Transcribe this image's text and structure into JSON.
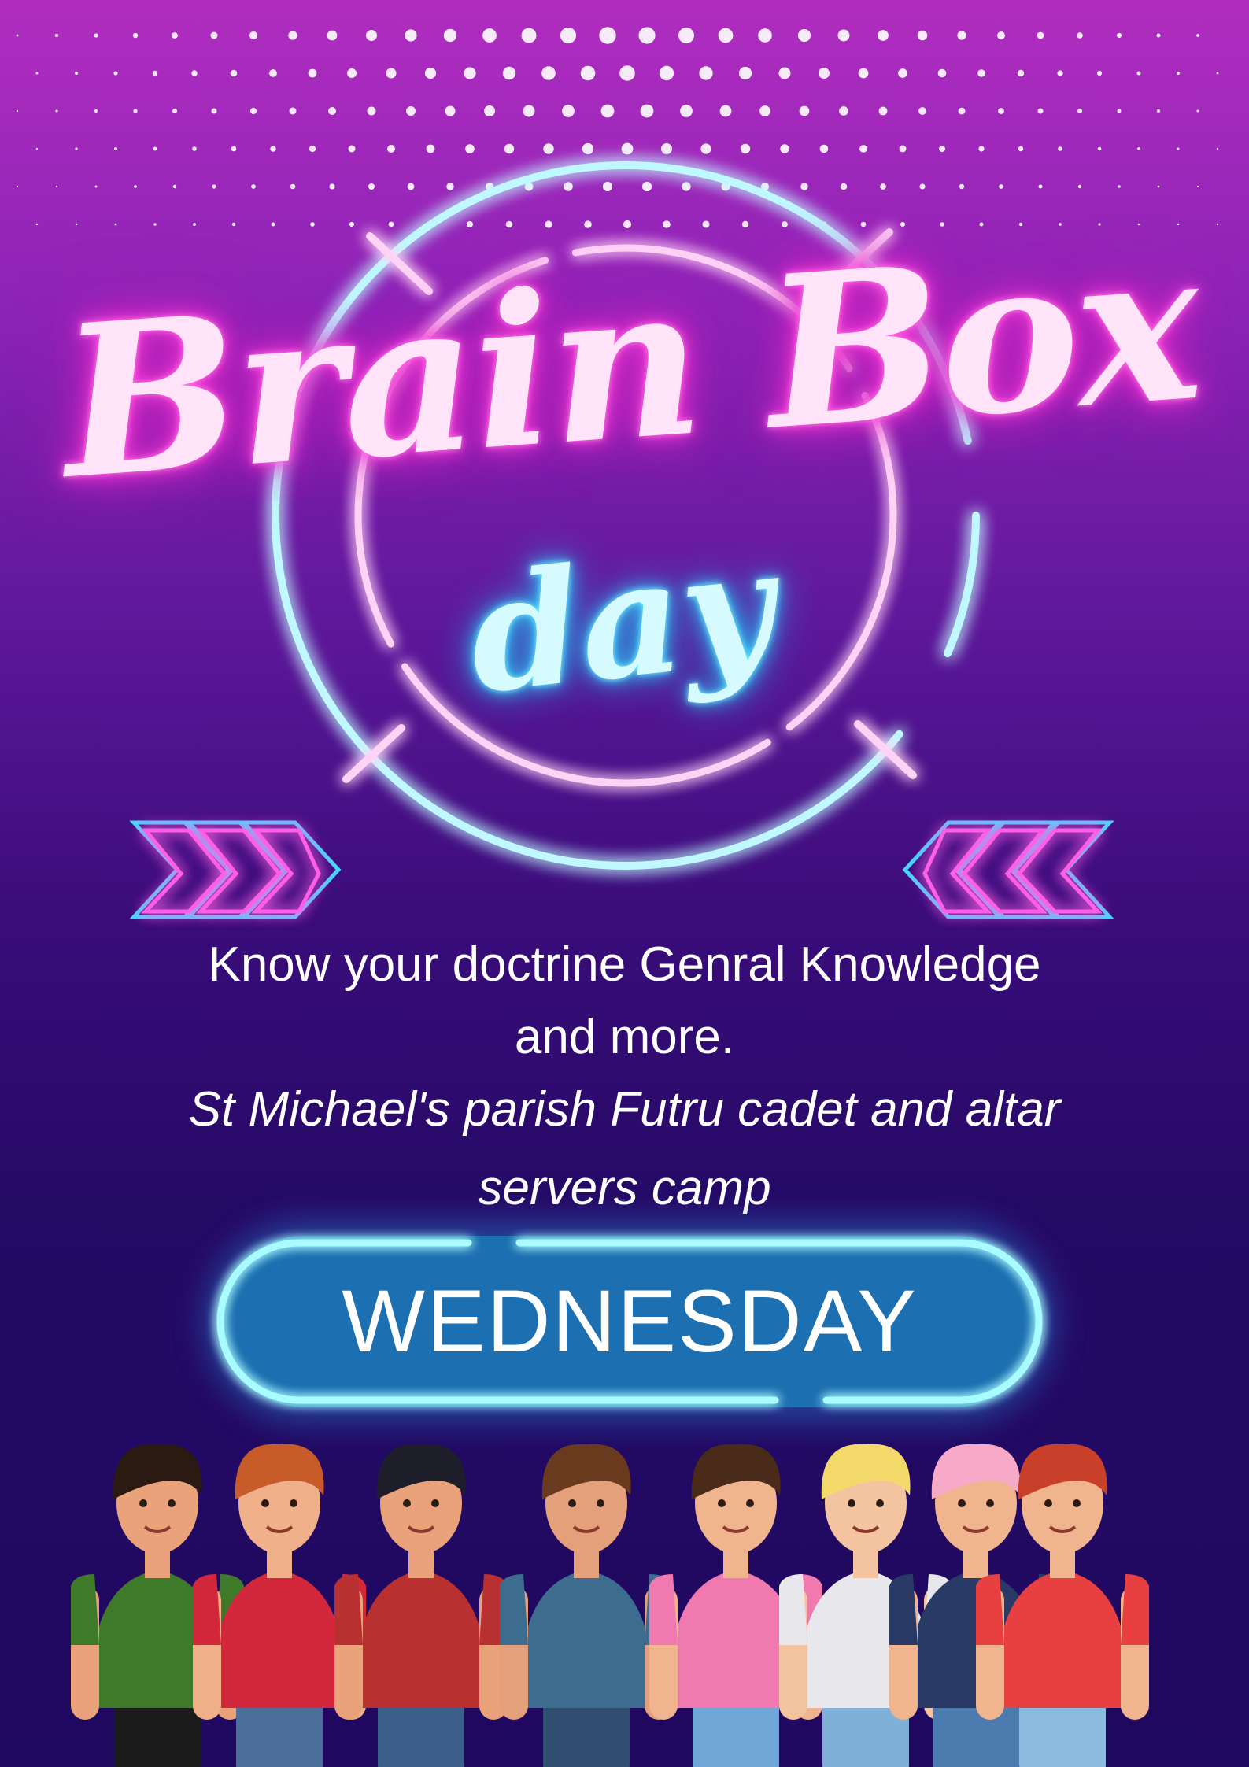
{
  "title": {
    "brain_box": "Brain Box",
    "day": "day"
  },
  "description": {
    "line1": "Know your doctrine Genral Knowledge",
    "line2": "and more.",
    "line3": "St Michael's parish Futru cadet and altar",
    "line4": "servers camp"
  },
  "event": {
    "weekday": "WEDNESDAY"
  },
  "colors": {
    "background_top": "#b02dbf",
    "background_bottom": "#1f0860",
    "neon_pink": "#ff43dc",
    "neon_cyan": "#35d8ff",
    "pill_fill": "#1c6fb0"
  },
  "illustration": {
    "group": "group-of-young-people-illustration",
    "count": 8
  }
}
